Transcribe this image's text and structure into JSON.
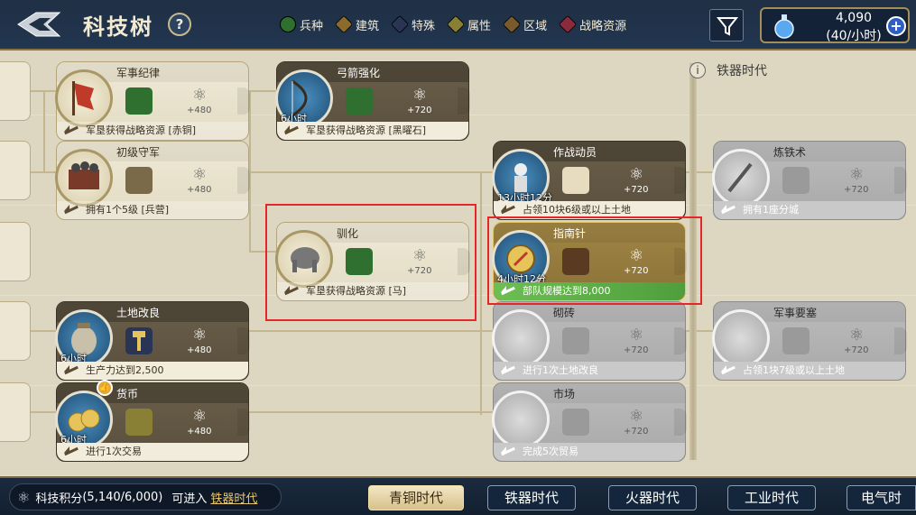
{
  "header": {
    "title": "科技树",
    "help_label": "?",
    "legend": [
      {
        "label": "兵种",
        "color": "#2f6f2f"
      },
      {
        "label": "建筑",
        "color": "#8b6a2e"
      },
      {
        "label": "特殊",
        "color": "#2a3556"
      },
      {
        "label": "属性",
        "color": "#8a8035"
      },
      {
        "label": "区域",
        "color": "#7a5a2a"
      },
      {
        "label": "战略资源",
        "color": "#8a2a3a"
      }
    ],
    "resource": {
      "value": "4,090",
      "rate": "(40/小时)",
      "plus": "+"
    }
  },
  "era": {
    "label": "铁器时代",
    "info": "i"
  },
  "cards": [
    {
      "name": "军事纪律",
      "points": "+480",
      "req": "军垦获得战略资源 [赤铜]",
      "time": "",
      "style": "light",
      "type_color": "#2f6f2f",
      "icon": "banner-icon"
    },
    {
      "name": "初级守军",
      "points": "+480",
      "req": "拥有1个5级 [兵营]",
      "time": "",
      "style": "light",
      "type_color": "#7a6a4a",
      "icon": "soldiers-icon"
    },
    {
      "name": "土地改良",
      "points": "+480",
      "req": "生产力达到2,500",
      "time": "6小时",
      "style": "dark",
      "type_color": "#2a3556",
      "icon": "hammer-icon"
    },
    {
      "name": "货币",
      "points": "+480",
      "req": "进行1次交易",
      "time": "6小时",
      "style": "dark",
      "type_color": "#8a8035",
      "icon": "coins-icon"
    },
    {
      "name": "弓箭强化",
      "points": "+720",
      "req": "军垦获得战略资源 [黑曜石]",
      "time": "6小时",
      "style": "dark",
      "type_color": "#2f6f2f",
      "icon": "bow-icon"
    },
    {
      "name": "驯化",
      "points": "+720",
      "req": "军垦获得战略资源 [马]",
      "time": "",
      "style": "light",
      "type_color": "#2f6f2f",
      "icon": "elephant-icon"
    },
    {
      "name": "作战动员",
      "points": "+720",
      "req": "占领10块6级或以上土地",
      "time": "13小时12分",
      "style": "dark",
      "type_color": "#e8dcc0",
      "icon": "knight-icon"
    },
    {
      "name": "指南针",
      "points": "+720",
      "req": "部队规模达到8,000",
      "time": "4小时12分",
      "style": "gold",
      "type_color": "#5a3a20",
      "icon": "compass-icon"
    },
    {
      "name": "砌砖",
      "points": "+720",
      "req": "进行1次土地改良",
      "time": "",
      "style": "grey",
      "type_color": "#9a9a9a",
      "icon": "trowel-icon"
    },
    {
      "name": "市场",
      "points": "+720",
      "req": "完成5次贸易",
      "time": "",
      "style": "grey",
      "type_color": "#9a9a9a",
      "icon": "cart-icon"
    },
    {
      "name": "炼铁术",
      "points": "+720",
      "req": "拥有1座分城",
      "time": "",
      "style": "grey",
      "type_color": "#9a9a9a",
      "icon": "sword-icon"
    },
    {
      "name": "军事要塞",
      "points": "+720",
      "req": "占领1块7级或以上土地",
      "time": "",
      "style": "grey",
      "type_color": "#9a9a9a",
      "icon": "fortress-icon"
    }
  ],
  "footer": {
    "score_label": "科技积分",
    "score_value": "(5,140/6,000)",
    "unlock_text": "可进入",
    "unlock_link": "铁器时代",
    "tabs": [
      "青铜时代",
      "铁器时代",
      "火器时代",
      "工业时代",
      "电气时"
    ],
    "active_tab": 0
  }
}
